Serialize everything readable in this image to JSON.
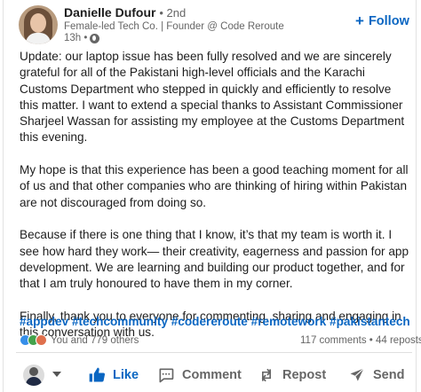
{
  "author": {
    "name": "Danielle Dufour",
    "degree": "• 2nd",
    "headline": "Female-led Tech Co. | Founder @ Code Reroute",
    "time": "13h •"
  },
  "follow_label": "Follow",
  "post": {
    "paragraphs": [
      "Update: our laptop issue has been fully resolved and we are sincerely grateful for all of the Pakistani high-level officials and the Karachi Customs Department who stepped in quickly and efficiently to resolve this matter. I want to extend a special thanks to Assistant Commissioner Sharjeel Wassan for assisting my employee at the Customs Department this evening.",
      "My hope is that this experience has been a good teaching moment for all of us and that other companies who are thinking of hiring within Pakistan are not discouraged from doing so.",
      "Because if there is one thing that I know, it’s that my team is worth it. I see how hard they work— their creativity, eagerness and passion for app development. We are learning and building our product together, and for that I am truly honoured to have them in my corner.",
      "Finally, thank you to everyone for commenting, sharing and engaging in this conversation with us."
    ],
    "hashtags": [
      "#appdev",
      "#techcommunity",
      "#codereroute",
      "#remotework",
      "#pakistantech"
    ]
  },
  "social": {
    "reactions_text": "You and 779 others",
    "comments_reposts": "117 comments • 44 reposts"
  },
  "actions": {
    "like": "Like",
    "comment": "Comment",
    "repost": "Repost",
    "send": "Send"
  },
  "colors": {
    "accent": "#0a66c2",
    "muted": "#666666",
    "like_reaction": "#378fe9",
    "celebrate_reaction": "#44a24c",
    "love_reaction": "#df704d"
  }
}
